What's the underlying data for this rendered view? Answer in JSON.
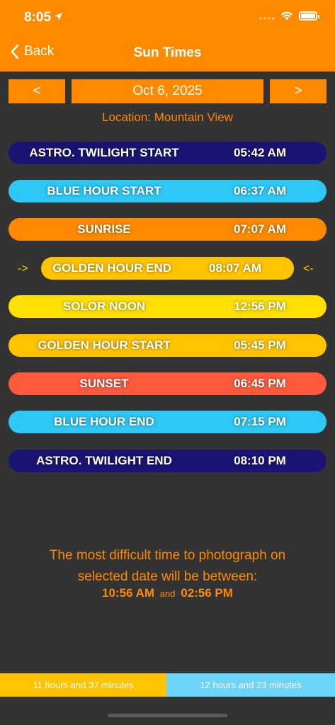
{
  "status": {
    "time": "8:05"
  },
  "nav": {
    "back_label": "Back",
    "title": "Sun Times"
  },
  "date_nav": {
    "prev_label": "<",
    "date": "Oct 6, 2025",
    "next_label": ">"
  },
  "location": "Location: Mountain View",
  "events": [
    {
      "label": "ASTRO. TWILIGHT START",
      "time": "05:42 AM",
      "color": "#1A1575"
    },
    {
      "label": "BLUE HOUR START",
      "time": "06:37 AM",
      "color": "#2DC8F5"
    },
    {
      "label": "SUNRISE",
      "time": "07:07 AM",
      "color": "#FF8A00"
    },
    {
      "label": "GOLDEN HOUR END",
      "time": "08:07 AM",
      "color": "#FFC400"
    },
    {
      "label": "SOLOR NOON",
      "time": "12:56 PM",
      "color": "#FFE000"
    },
    {
      "label": "GOLDEN HOUR START",
      "time": "05:45 PM",
      "color": "#FFC400"
    },
    {
      "label": "SUNSET",
      "time": "06:45 PM",
      "color": "#FF5A3C"
    },
    {
      "label": "BLUE HOUR END",
      "time": "07:15 PM",
      "color": "#2DC8F5"
    },
    {
      "label": "ASTRO. TWILIGHT END",
      "time": "08:10 PM",
      "color": "#1A1575"
    }
  ],
  "current_markers": {
    "left": "->",
    "right": "<-"
  },
  "difficult": {
    "line1": "The most difficult time to photograph on",
    "line2": "selected date will be between:",
    "start": "10:56 AM",
    "and": "and",
    "end": "02:56 PM"
  },
  "footer": {
    "left": "11 hours and 37 minutes",
    "right": "12 hours and 23 minutes"
  },
  "colors": {
    "accent": "#FF8A00",
    "background": "#333333",
    "footer_left": "#FFC400",
    "footer_right": "#6DD5FA"
  }
}
